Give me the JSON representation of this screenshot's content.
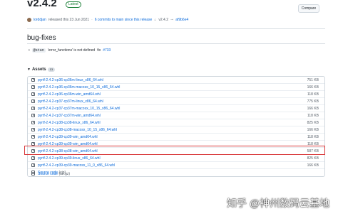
{
  "release": {
    "version": "v2.4.2",
    "badge": "Latest",
    "author": "lorddjan",
    "released_text": "released this 23 Jun 2021",
    "commits_text": "6 commits to main since this release",
    "tag": "v2.4.2",
    "commit": "af9b6e4",
    "compare_label": "Compare"
  },
  "bug_fixes": {
    "title": "bug-fixes",
    "items": [
      {
        "author": "@stan",
        "code": "'error_functions' is not defined",
        "fix_text": "fix",
        "link": "#733"
      }
    ]
  },
  "assets": {
    "title": "Assets",
    "count": "13",
    "items": [
      {
        "name": "pyrtf-2.4.2-cp36-cp36m-linux_x86_64.whl",
        "size": "751 KB",
        "type": "package"
      },
      {
        "name": "pyrtf-2.4.2-cp36-cp36m-macosx_10_15_x86_64.whl",
        "size": "166 KB",
        "type": "package"
      },
      {
        "name": "pyrtf-2.4.2-cp36-cp36m-win_amd64.whl",
        "size": "118 KB",
        "type": "package"
      },
      {
        "name": "pyrtf-2.4.2-cp37-cp37m-linux_x86_64.whl",
        "size": "775 KB",
        "type": "package"
      },
      {
        "name": "pyrtf-2.4.2-cp37-cp37m-macosx_10_15_x86_64.whl",
        "size": "166 KB",
        "type": "package"
      },
      {
        "name": "pyrtf-2.4.2-cp37-cp37m-win_amd64.whl",
        "size": "118 KB",
        "type": "package"
      },
      {
        "name": "pyrtf-2.4.2-cp38-cp38-linux_x86_64.whl",
        "size": "825 KB",
        "type": "package"
      },
      {
        "name": "pyrtf-2.4.2-cp38-cp38-macosx_10_15_x86_64.whl",
        "size": "166 KB",
        "type": "package"
      },
      {
        "name": "pyrtf-2.4.2-cp38-cp38-win_amd64.whl",
        "size": "587 KB",
        "type": "package"
      },
      {
        "name": "pyrtf-2.4.2-cp39-cp39-linux_x86_64.whl",
        "size": "825 KB",
        "type": "package"
      },
      {
        "name": "pyrtf-2.4.2-cp39-cp39-macosx_11_0_x86_64.whl",
        "size": "166 KB",
        "type": "package"
      },
      {
        "name": "pyrtf-2.4.2-cp39-cp39-win_amd64.whl",
        "size": "118 KB",
        "type": "package"
      },
      {
        "name": "Source code",
        "suffix": "(zip)",
        "size": "",
        "type": "zip"
      },
      {
        "name": "Source code",
        "suffix": "(tar.gz)",
        "size": "",
        "type": "zip"
      }
    ]
  },
  "watermark": "知乎 @神州数码云基地",
  "colors": {
    "link": "#0969da",
    "highlight_border": "#d9383a",
    "latest_badge": "#1a7f37"
  }
}
